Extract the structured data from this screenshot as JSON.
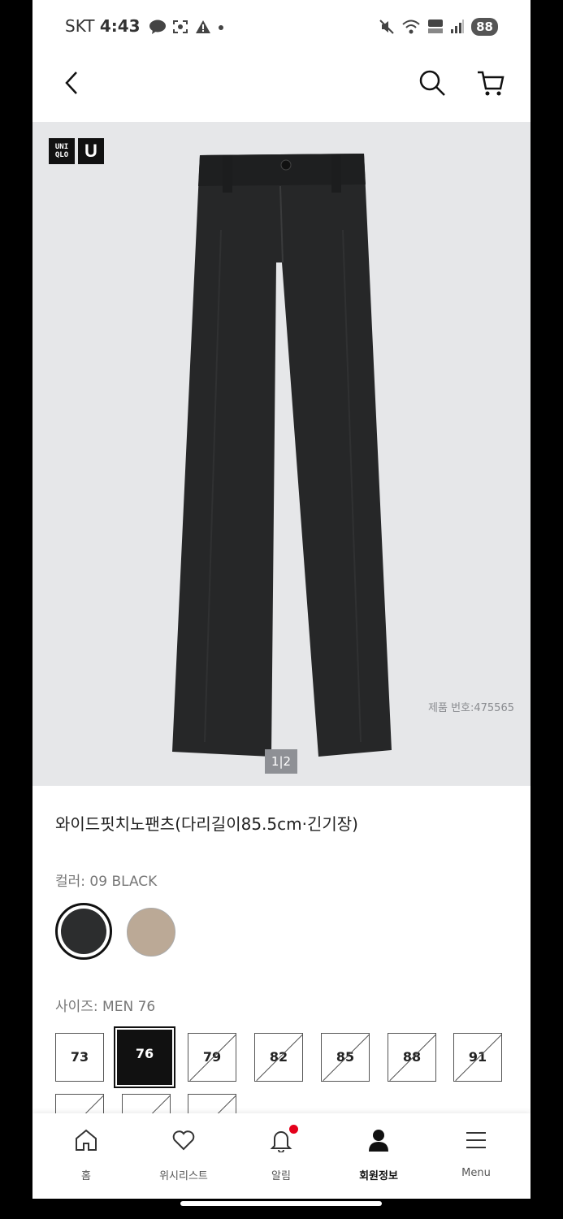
{
  "status_bar": {
    "carrier": "SKT",
    "time": "4:43",
    "battery": "88"
  },
  "brand_logo": {
    "text_top": "UNI",
    "text_bottom": "QLO",
    "u_mark": "U"
  },
  "product": {
    "product_number": "제품 번호:475565",
    "pager_current": "1",
    "pager_total": "2",
    "title": "와이드핏치노팬츠(다리길이85.5cm·긴기장)",
    "color_label": "컬러: 09 BLACK",
    "colors": [
      {
        "name": "black",
        "hex": "#2c2d2e",
        "selected": true
      },
      {
        "name": "beige",
        "hex": "#bba996",
        "selected": false
      }
    ],
    "size_label": "사이즈: MEN 76",
    "sizes": [
      {
        "label": "73",
        "available": true,
        "selected": false
      },
      {
        "label": "76",
        "available": true,
        "selected": true
      },
      {
        "label": "79",
        "available": false,
        "selected": false
      },
      {
        "label": "82",
        "available": false,
        "selected": false
      },
      {
        "label": "85",
        "available": false,
        "selected": false
      },
      {
        "label": "88",
        "available": false,
        "selected": false
      },
      {
        "label": "91",
        "available": false,
        "selected": false
      }
    ]
  },
  "bottom_nav": [
    {
      "label": "홈",
      "icon": "home-icon"
    },
    {
      "label": "위시리스트",
      "icon": "heart-icon"
    },
    {
      "label": "알림",
      "icon": "bell-icon"
    },
    {
      "label": "회원정보",
      "icon": "person-icon"
    },
    {
      "label": "Menu",
      "icon": "menu-icon"
    }
  ],
  "colors": {
    "accent": "#e4001b",
    "hero_bg": "#e6e7e9"
  }
}
